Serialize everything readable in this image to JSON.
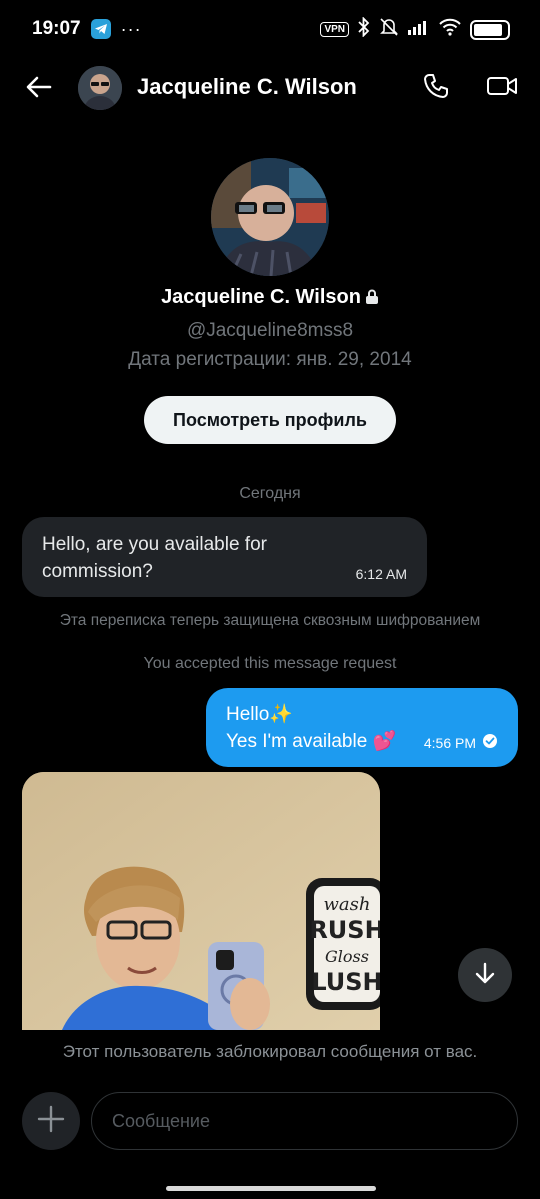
{
  "status_bar": {
    "time": "19:07",
    "dots": "···",
    "vpn": "VPN",
    "telegram_icon": "telegram-icon",
    "icons": [
      "vpn-badge",
      "bluetooth-icon",
      "silent-icon",
      "signal-icon",
      "wifi-icon",
      "battery-icon"
    ]
  },
  "header": {
    "name": "Jacqueline C. Wilson",
    "icons": [
      "back-arrow-icon",
      "phone-icon",
      "video-icon"
    ]
  },
  "profile": {
    "name": "Jacqueline C. Wilson",
    "handle": "@Jacqueline8mss8",
    "joined": "Дата регистрации: янв. 29, 2014",
    "view_profile_label": "Посмотреть профиль",
    "lock_icon": "lock-icon"
  },
  "conversation": {
    "day_label": "Сегодня",
    "incoming": {
      "text": "Hello, are you available for commission?",
      "time": "6:12 AM"
    },
    "encrypted_notice": "Эта переписка теперь защищена сквозным шифрованием",
    "accepted_notice": "You accepted this message request",
    "outgoing": {
      "line1": "Hello✨",
      "line2": "Yes I'm available 💕",
      "time": "4:56 PM",
      "status_icon": "read-check-icon"
    },
    "photo_sign_text": [
      "wash",
      "RUSH",
      "Gloss",
      "LUSH"
    ]
  },
  "blocked_notice": "Этот пользователь заблокировал сообщения от вас.",
  "composer": {
    "placeholder": "Сообщение",
    "value": ""
  },
  "colors": {
    "background": "#000000",
    "accent": "#1d9bf0",
    "incoming_bubble": "#202327",
    "muted_text": "#71767b"
  }
}
